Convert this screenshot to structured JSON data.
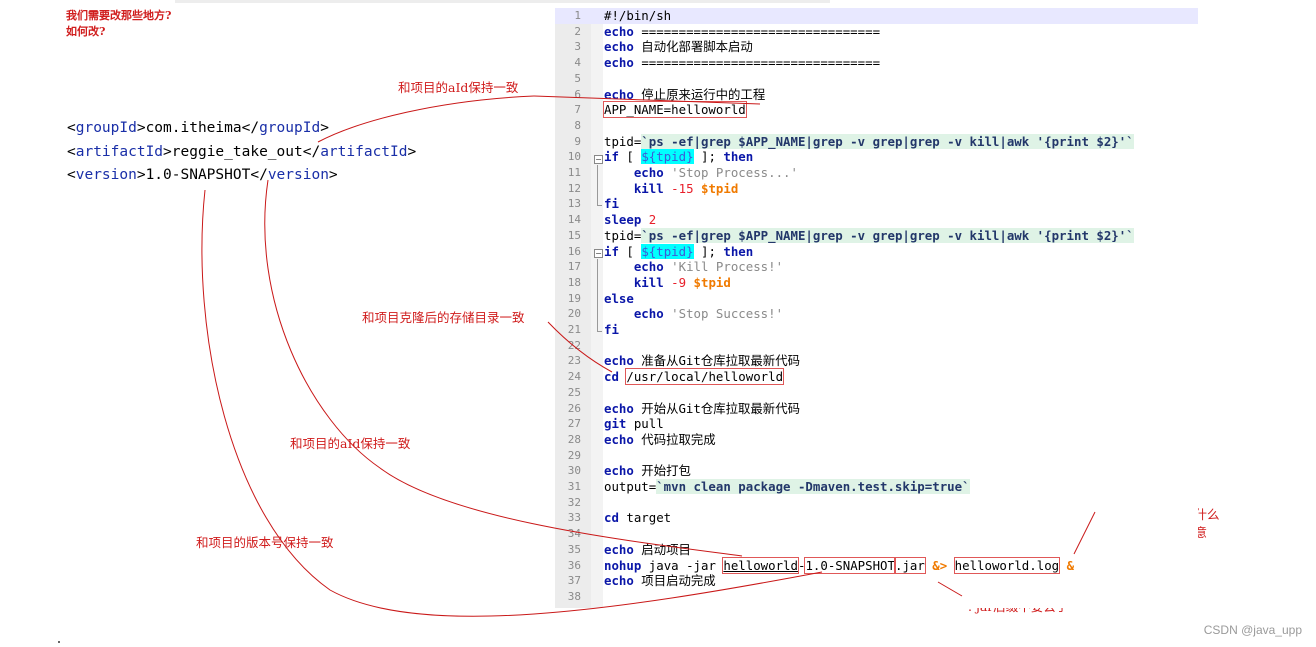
{
  "annotations": {
    "question_line1": "我们需要改那些地方?",
    "question_line2": "如何改?",
    "aid_top": "和项目的aId保持一致",
    "clone_dir": "和项目克隆后的存储目录一致",
    "aid_mid": "和项目的aId保持一致",
    "version": "和项目的版本号保持一致",
    "log_line1": "日志文件名称, 叫什么",
    "log_line2": "都行, 但要见名知意",
    "jar_suffix": ". jar后缀不要丢了"
  },
  "xml": {
    "group_open": "<groupId>",
    "group_value": "com.itheima",
    "group_close": "</groupId>",
    "artifact_open": "<artifactId>",
    "artifact_value": "reggie_take_out",
    "artifact_close": "</artifactId>",
    "version_open": "<version>",
    "version_value": "1.0-SNAPSHOT",
    "version_close": "</version>",
    "lt": "<",
    "gt": ">",
    "lt_slash": "</",
    "tag_group": "groupId",
    "tag_artifact": "artifactId",
    "tag_version": "version"
  },
  "editor": {
    "line_numbers": [
      "1",
      "2",
      "3",
      "4",
      "5",
      "6",
      "7",
      "8",
      "9",
      "10",
      "11",
      "12",
      "13",
      "14",
      "15",
      "16",
      "17",
      "18",
      "19",
      "20",
      "21",
      "22",
      "23",
      "24",
      "25",
      "26",
      "27",
      "28",
      "29",
      "30",
      "31",
      "32",
      "33",
      "34",
      "35",
      "36",
      "37",
      "38"
    ],
    "l1": "#!/bin/sh",
    "echo": "echo",
    "separator": "================================",
    "l3_text": "  自动化部署脚本启动",
    "l6_text": " 停止原来运行中的工程",
    "l7": "APP_NAME=helloworld",
    "tpid_assign": "tpid=",
    "tpid_cmd": "`ps -ef|grep $APP_NAME|grep -v grep|grep -v kill|awk '{print $2}'`",
    "if": "if",
    "if_open": " [ ",
    "tpid_var": "${tpid}",
    "if_close": " ]; ",
    "then": "then",
    "stop_process": " 'Stop Process...'",
    "kill": "kill",
    "kill15": " -15 ",
    "tpid_dollar": "$tpid",
    "fi": "fi",
    "sleep": "sleep",
    "sleep_num": " 2",
    "kill_process": " 'Kill Process!'",
    "kill9": " -9 ",
    "else": "else",
    "stop_success": " 'Stop Success!'",
    "l23_text": " 准备从Git仓库拉取最新代码",
    "cd": "cd",
    "cd_path": "/usr/local/helloworld",
    "l25_text": " 开始从Git仓库拉取最新代码",
    "git": "git",
    "pull": " pull",
    "l28_text": " 代码拉取完成",
    "l30_text": " 开始打包",
    "output_assign": "output=",
    "output_cmd": "`mvn clean package -Dmaven.test.skip=true`",
    "target": " target",
    "l35_text": " 启动项目",
    "nohup": "nohup",
    "java_jar": " java -jar ",
    "jar_name": "helloworld",
    "jar_dash": "-",
    "jar_version": "1.0-SNAPSHOT",
    "jar_ext": ".jar",
    "redirect": " &> ",
    "log_file": "helloworld.log",
    "amp": " &",
    "l37_text": " 项目启动完成"
  },
  "watermark": "CSDN @java_upp",
  "colors": {
    "annotation_red": "#d01d1d",
    "keyword_blue": "#0a16a8",
    "xml_tag_blue": "#1a2fa8",
    "var_highlight": "#00ffff",
    "dollar_var_orange": "#f07a00",
    "string_gray": "#8a8a8a",
    "number_red": "#e8202b",
    "backtick_green_bg": "#dff3e6"
  }
}
